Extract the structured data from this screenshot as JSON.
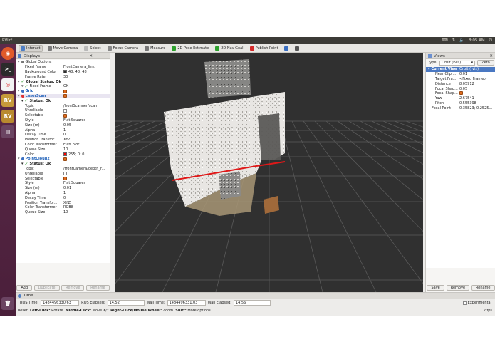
{
  "window": {
    "title": "RViz*",
    "clock": "8:05 AM",
    "tray": [
      "En",
      "vol",
      "net",
      "mail"
    ]
  },
  "launcher": [
    "ubuntu",
    "terminal",
    "chrome",
    "RViz",
    "RViz",
    "files",
    "trash"
  ],
  "toolbar": [
    {
      "label": "Interact",
      "icon": "hand-icon",
      "color": "#4f7fc5",
      "active": true
    },
    {
      "label": "Move Camera",
      "icon": "move-camera-icon",
      "color": "#7a7a7a"
    },
    {
      "label": "Select",
      "icon": "select-icon",
      "color": "#b9b9b9"
    },
    {
      "label": "Focus Camera",
      "icon": "focus-camera-icon",
      "color": "#888888"
    },
    {
      "label": "Measure",
      "icon": "measure-icon",
      "color": "#777777"
    },
    {
      "label": "2D Pose Estimate",
      "icon": "pose-estimate-icon",
      "color": "#2da12d"
    },
    {
      "label": "2D Nav Goal",
      "icon": "nav-goal-icon",
      "color": "#2da12d"
    },
    {
      "label": "Publish Point",
      "icon": "publish-point-icon",
      "color": "#d42a2a"
    },
    {
      "label": "",
      "icon": "plus-move-icon",
      "color": "#3a6fc2"
    },
    {
      "label": "",
      "icon": "minus-icon",
      "color": "#555555"
    }
  ],
  "displays": {
    "title": "Displays",
    "rows": [
      {
        "indent": 0,
        "k": "Global Options",
        "v": "",
        "kind": "gear"
      },
      {
        "indent": 2,
        "k": "Fixed Frame",
        "v": "FrontCamera_link"
      },
      {
        "indent": 2,
        "k": "Background Color",
        "v": "48; 48; 48",
        "swatch": "#303030"
      },
      {
        "indent": 2,
        "k": "Frame Rate",
        "v": "30"
      },
      {
        "indent": 0,
        "k": "Global Status: Ok",
        "v": "",
        "kind": "ok",
        "bold": true
      },
      {
        "indent": 1,
        "k": "Fixed Frame",
        "v": "OK",
        "kind": "ok"
      },
      {
        "indent": 0,
        "k": "Grid",
        "v": "",
        "kind": "grid",
        "blue": true,
        "check": true
      },
      {
        "indent": 0,
        "k": "LaserScan",
        "v": "",
        "kind": "laser",
        "blue": true,
        "check": true,
        "sel": true
      },
      {
        "indent": 1,
        "k": "Status: Ok",
        "v": "",
        "kind": "ok",
        "bold": true
      },
      {
        "indent": 2,
        "k": "Topic",
        "v": "/frontScanner/scan"
      },
      {
        "indent": 2,
        "k": "Unreliable",
        "v": "",
        "check_v": "off"
      },
      {
        "indent": 2,
        "k": "Selectable",
        "v": "",
        "check_v": "on"
      },
      {
        "indent": 2,
        "k": "Style",
        "v": "Flat Squares"
      },
      {
        "indent": 2,
        "k": "Size (m)",
        "v": "0.05"
      },
      {
        "indent": 2,
        "k": "Alpha",
        "v": "1"
      },
      {
        "indent": 2,
        "k": "Decay Time",
        "v": "0"
      },
      {
        "indent": 2,
        "k": "Position Transfor...",
        "v": "XYZ"
      },
      {
        "indent": 2,
        "k": "Color Transformer",
        "v": "FlatColor"
      },
      {
        "indent": 2,
        "k": "Queue Size",
        "v": "10"
      },
      {
        "indent": 2,
        "k": "Color",
        "v": "255; 0; 0",
        "swatch": "#ff0000"
      },
      {
        "indent": 0,
        "k": "PointCloud2",
        "v": "",
        "kind": "cloud",
        "blue": true,
        "check": true
      },
      {
        "indent": 1,
        "k": "Status: Ok",
        "v": "",
        "kind": "ok",
        "bold": true
      },
      {
        "indent": 2,
        "k": "Topic",
        "v": "/frontCamera/depth_r..."
      },
      {
        "indent": 2,
        "k": "Unreliable",
        "v": "",
        "check_v": "off"
      },
      {
        "indent": 2,
        "k": "Selectable",
        "v": "",
        "check_v": "on"
      },
      {
        "indent": 2,
        "k": "Style",
        "v": "Flat Squares"
      },
      {
        "indent": 2,
        "k": "Size (m)",
        "v": "0.01"
      },
      {
        "indent": 2,
        "k": "Alpha",
        "v": "1"
      },
      {
        "indent": 2,
        "k": "Decay Time",
        "v": "0"
      },
      {
        "indent": 2,
        "k": "Position Transfor...",
        "v": "XYZ"
      },
      {
        "indent": 2,
        "k": "Color Transformer",
        "v": "RGB8"
      },
      {
        "indent": 2,
        "k": "Queue Size",
        "v": "10"
      }
    ],
    "buttons": [
      "Add",
      "Duplicate",
      "Remove",
      "Rename"
    ]
  },
  "views": {
    "title": "Views",
    "type_label": "Type:",
    "type_value": "Orbit (rviz)",
    "zero": "Zero",
    "rows": [
      {
        "indent": 0,
        "k": "Current View",
        "v": "Orbit (rviz)",
        "sel": true,
        "bold": true
      },
      {
        "indent": 2,
        "k": "Near Clip ...",
        "v": "0.01"
      },
      {
        "indent": 2,
        "k": "Target Fra...",
        "v": "<Fixed Frame>"
      },
      {
        "indent": 2,
        "k": "Distance",
        "v": "8.05912"
      },
      {
        "indent": 2,
        "k": "Focal Shap...",
        "v": "0.05"
      },
      {
        "indent": 2,
        "k": "Focal Shap...",
        "v": "",
        "check_v": "on"
      },
      {
        "indent": 2,
        "k": "Yaw",
        "v": "2.67541"
      },
      {
        "indent": 2,
        "k": "Pitch",
        "v": "0.555398"
      },
      {
        "indent": 1,
        "k": "Focal Point",
        "v": "0.35823; 0.2525..."
      }
    ],
    "buttons": [
      "Save",
      "Remove",
      "Rename"
    ]
  },
  "time": {
    "title": "Time",
    "ros_time_label": "ROS Time:",
    "ros_time": "1484496330.63",
    "ros_elapsed_label": "ROS Elapsed:",
    "ros_elapsed": "14.52",
    "wall_time_label": "Wall Time:",
    "wall_time": "1484496331.03",
    "wall_elapsed_label": "Wall Elapsed:",
    "wall_elapsed": "14.56",
    "experimental": "Experimental",
    "fps": "2 fps"
  },
  "status": {
    "reset": "Reset",
    "p1b": "Left-Click:",
    "p1": " Rotate. ",
    "p2b": "Middle-Click:",
    "p2": " Move X/Y. ",
    "p3b": "Right-Click/Mouse Wheel:",
    "p3": " Zoom. ",
    "p4b": "Shift:",
    "p4": " More options."
  }
}
